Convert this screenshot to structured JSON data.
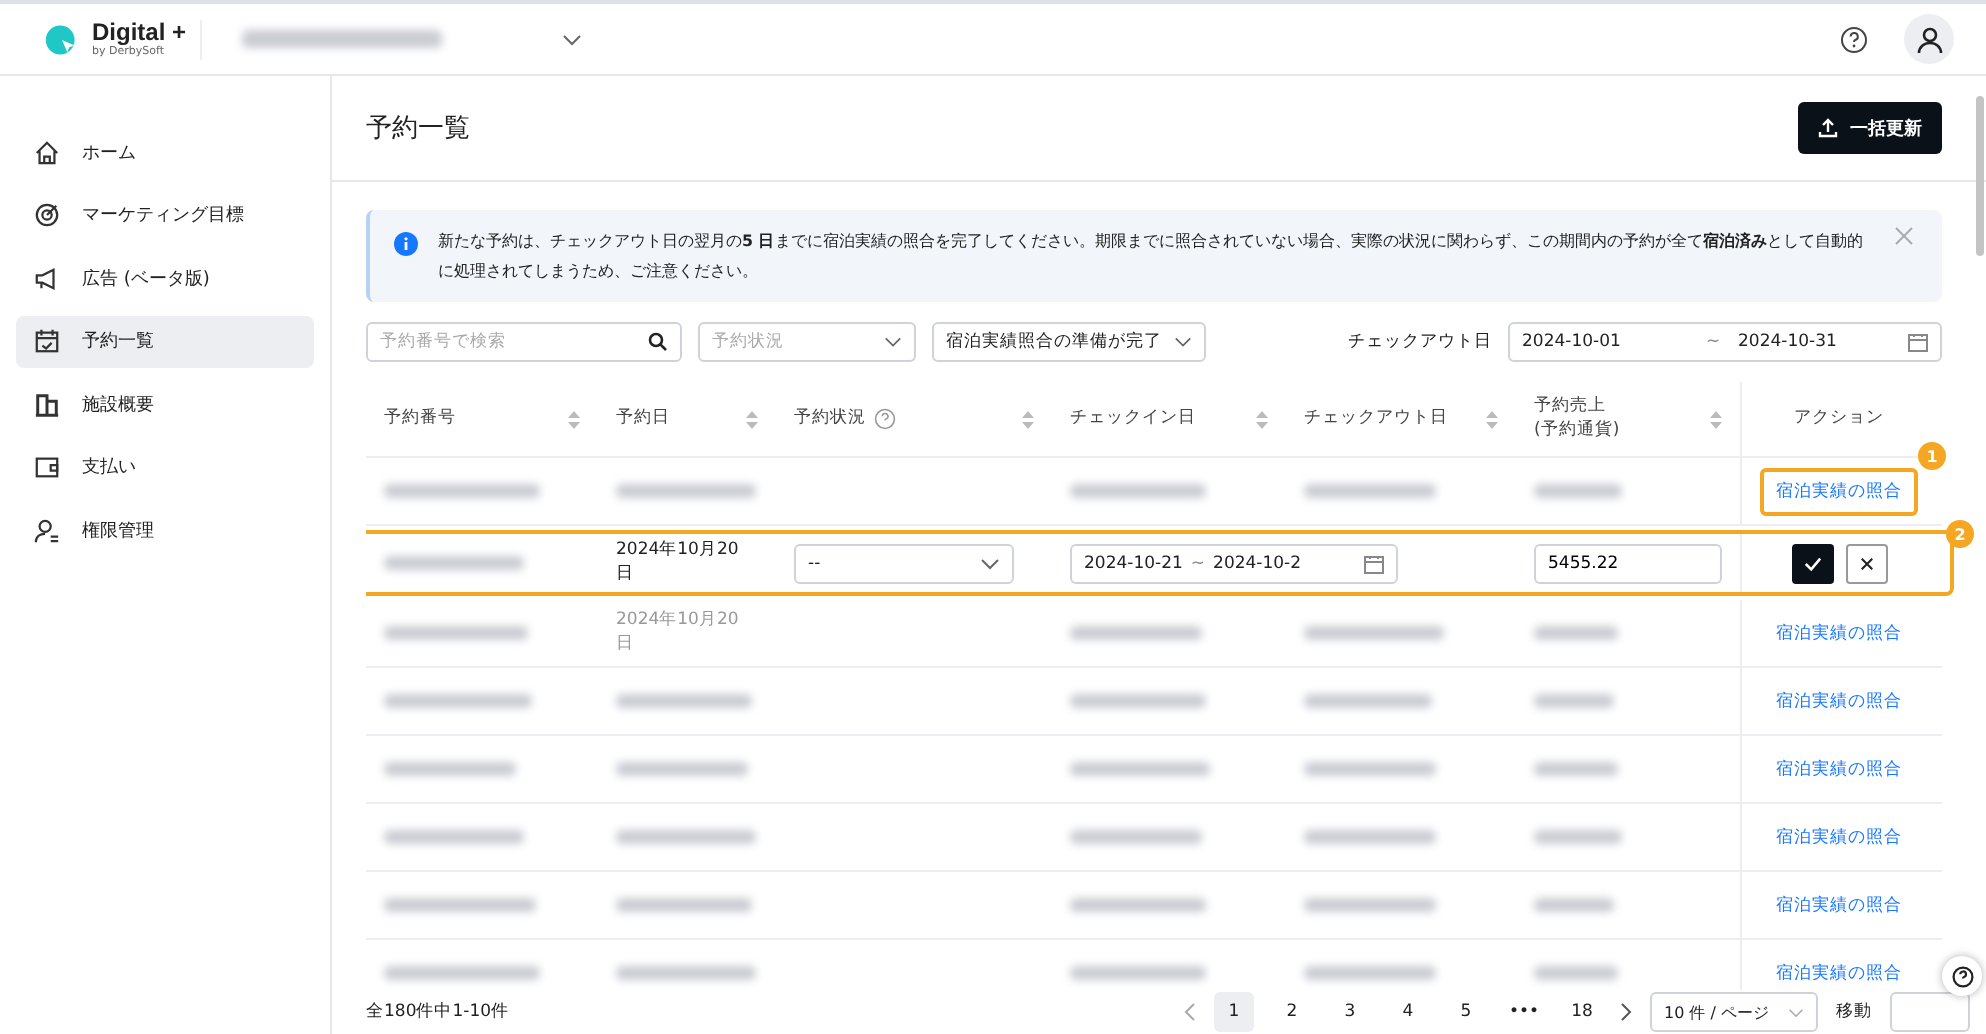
{
  "header": {
    "brand": "Digital +",
    "brand_sub": "by DerbySoft"
  },
  "sidebar": {
    "items": [
      {
        "label": "ホーム",
        "selected": false
      },
      {
        "label": "マーケティング目標",
        "selected": false
      },
      {
        "label": "広告 (ベータ版)",
        "selected": false
      },
      {
        "label": "予約一覧",
        "selected": true
      },
      {
        "label": "施設概要",
        "selected": false
      },
      {
        "label": "支払い",
        "selected": false
      },
      {
        "label": "権限管理",
        "selected": false
      }
    ]
  },
  "page": {
    "title": "予約一覧",
    "bulk_button": "一括更新"
  },
  "notice": {
    "text": "新たな予約は、チェックアウト日の翌月の**5 日**までに宿泊実績の照合を完了してください。期限までに照合されていない場合、実際の状況に関わらず、この期間内の予約が全て**宿泊済み**として自動的に処理されてしまうため、ご注意ください。"
  },
  "filters": {
    "search_placeholder": "予約番号で検索",
    "status_placeholder": "予約状況",
    "ready_value": "宿泊実績照合の準備が完了",
    "checkout_label": "チェックアウト日",
    "checkout_from": "2024-10-01",
    "separator": "~",
    "checkout_to": "2024-10-31"
  },
  "table": {
    "columns": [
      {
        "label": "予約番号"
      },
      {
        "label": "予約日"
      },
      {
        "label": "予約状況"
      },
      {
        "label": "チェックイン日"
      },
      {
        "label": "チェックアウト日"
      },
      {
        "label": "予約売上\n(予約通貨)"
      },
      {
        "label": "アクション"
      }
    ],
    "rows": [
      {
        "kind": "view",
        "action": "宿泊実績の照合",
        "callout": "1"
      },
      {
        "kind": "edit",
        "date": "2024年10月20日",
        "status": "--",
        "checkin": "2024-10-21",
        "range_sep": "~",
        "checkout": "2024-10-2",
        "amount": "5455.22",
        "callout": "2"
      },
      {
        "kind": "view",
        "date": "2024年10月20日",
        "action": "宿泊実績の照合"
      },
      {
        "kind": "view",
        "action": "宿泊実績の照合"
      },
      {
        "kind": "view",
        "action": "宿泊実績の照合"
      },
      {
        "kind": "view",
        "action": "宿泊実績の照合"
      },
      {
        "kind": "view",
        "action": "宿泊実績の照合"
      },
      {
        "kind": "view",
        "action": "宿泊実績の照合"
      }
    ]
  },
  "pagination": {
    "summary": "全180件中1-10件",
    "pages": [
      {
        "label": "1",
        "selected": true
      },
      {
        "label": "2",
        "selected": false
      },
      {
        "label": "3",
        "selected": false
      },
      {
        "label": "4",
        "selected": false
      },
      {
        "label": "5",
        "selected": false
      },
      {
        "label": "•••",
        "selected": false
      },
      {
        "label": "18",
        "selected": false
      }
    ],
    "page_size": "10 件 / ページ",
    "goto_label": "移動"
  }
}
